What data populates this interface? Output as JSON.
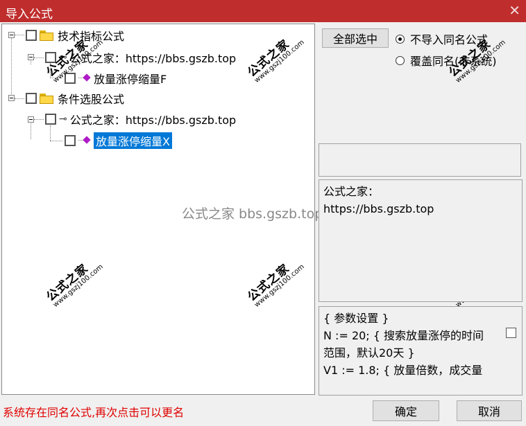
{
  "window": {
    "title": "导入公式",
    "close_glyph": "✕"
  },
  "tree": {
    "nodes": [
      {
        "label": "技术指标公式"
      },
      {
        "label": "公式之家：https://bbs.gszb.top"
      },
      {
        "label": "放量涨停缩量F"
      },
      {
        "label": "条件选股公式"
      },
      {
        "label": "公式之家：https://bbs.gszb.top"
      },
      {
        "label": "放量涨停缩量X"
      }
    ]
  },
  "watermark": {
    "mark": "公式之家",
    "url": "www.gszj100.com",
    "center_text": "公式之家 bbs.gszb.top"
  },
  "options": {
    "select_all_label": "全部选中",
    "radio_skip_label": "不导入同名公式",
    "radio_overwrite_label": "覆盖同名(非系统)",
    "selected": "skip"
  },
  "description": {
    "line1": "公式之家：",
    "line2": "https://bbs.gszb.top"
  },
  "params": {
    "lines": [
      "{ 参数设置 }",
      "N := 20; { 搜索放量涨停的时间",
      "范围，默认20天 }",
      "V1 := 1.8; { 放量倍数，成交量"
    ]
  },
  "status_text": "系统存在同名公式,再次点击可以更名",
  "buttons": {
    "ok": "确定",
    "cancel": "取消"
  },
  "colors": {
    "titlebar": "#c02d2d",
    "selection": "#0078d7",
    "status": "#e00000",
    "gem": "#b01bc8"
  }
}
